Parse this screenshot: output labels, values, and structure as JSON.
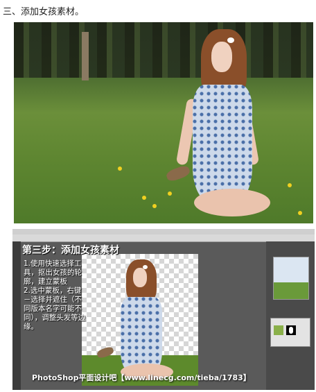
{
  "heading": "三、添加女孩素材。",
  "tutorial": {
    "title": "第三步：添加女孩素材",
    "steps": [
      "1.使用快速选择工具，抠出女孩的轮廓，建立蒙板",
      "2.选中蒙板，右键－选择并遮住（不同版本名字可能不同），调整头发等边缘。"
    ],
    "watermark": "PhotoShop平面设计吧【www.linecg.com/tieba/1783】"
  },
  "icons": {
    "canvas_icon": "photo-canvas-icon",
    "mask_icon": "layer-mask-icon"
  },
  "colors": {
    "grass": "#5d8a2c",
    "hair": "#8a4f2a",
    "dress": "#cdd9ea"
  }
}
